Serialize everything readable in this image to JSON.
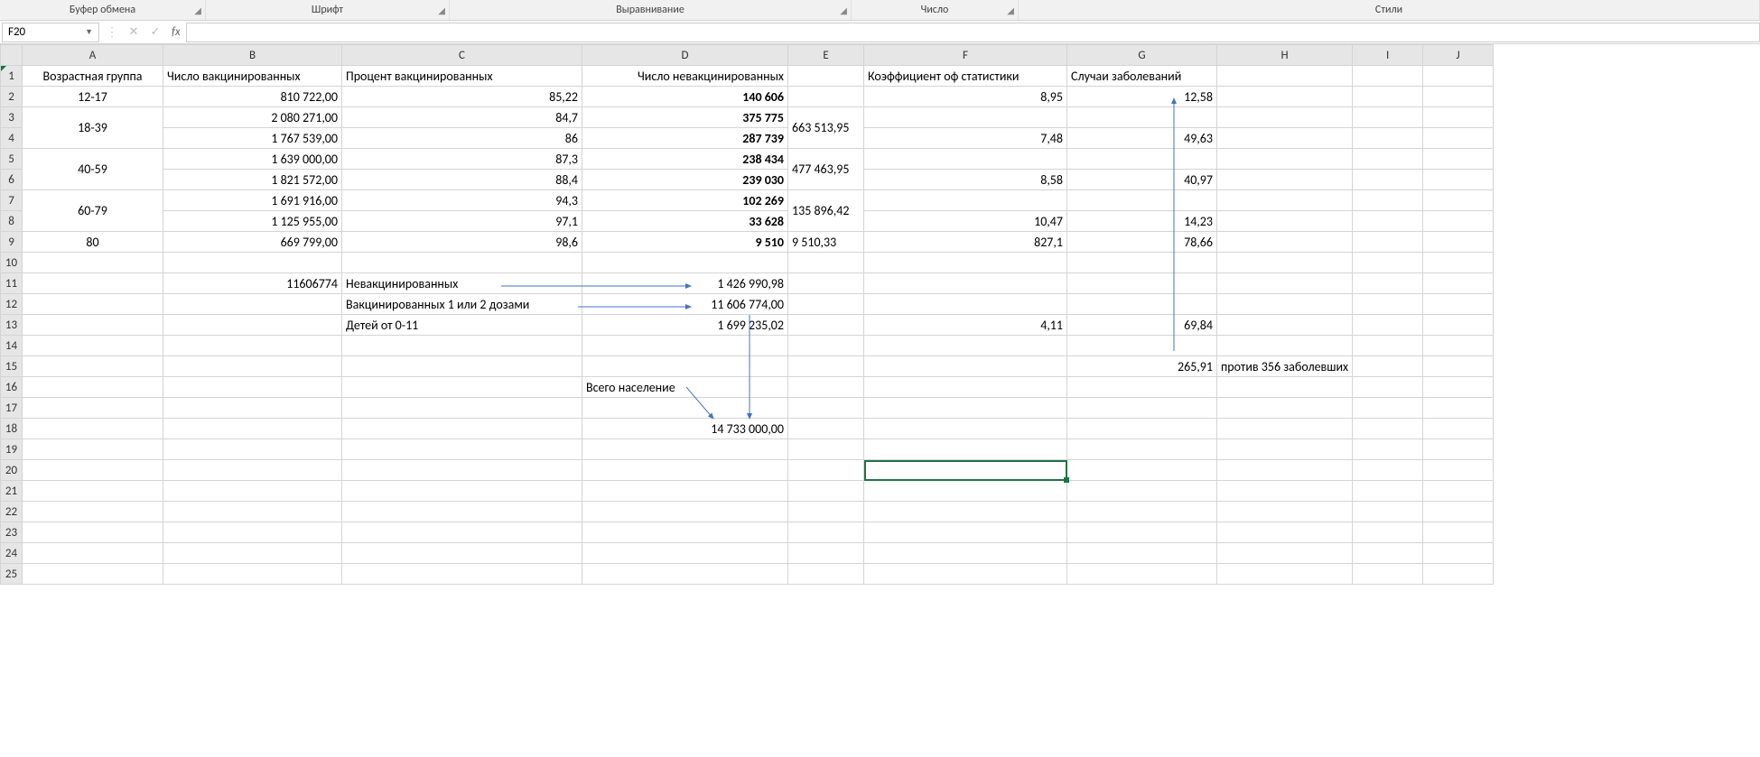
{
  "ribbon": {
    "groups": [
      "Буфер обмена",
      "Шрифт",
      "Выравнивание",
      "Число",
      "Стили"
    ]
  },
  "nameBox": "F20",
  "fx": "fx",
  "columns": [
    "A",
    "B",
    "C",
    "D",
    "E",
    "F",
    "G",
    "H",
    "I",
    "J"
  ],
  "rows": [
    "1",
    "2",
    "3",
    "4",
    "5",
    "6",
    "7",
    "8",
    "9",
    "10",
    "11",
    "12",
    "13",
    "14",
    "15",
    "16",
    "17",
    "18",
    "19",
    "20",
    "21",
    "22",
    "23",
    "24",
    "25"
  ],
  "cells": {
    "A1": "Возрастная группа",
    "B1": "Число вакцинированных",
    "C1": "Процент вакцинированных",
    "D1": "Число невакцинированных",
    "F1": "Коэффициент оф статистики",
    "G1": "Случаи заболеваний",
    "A2": "12-17",
    "B2": "810 722,00",
    "C2": "85,22",
    "D2": "140 606",
    "F2": "8,95",
    "G2": "12,58",
    "A3": "18-39",
    "B3": "2 080 271,00",
    "C3": "84,7",
    "D3": "375 775",
    "E3": "663 513,95",
    "B4": "1 767 539,00",
    "C4": "86",
    "D4": "287 739",
    "F4": "7,48",
    "G4": "49,63",
    "A5": "40-59",
    "B5": "1 639 000,00",
    "C5": "87,3",
    "D5": "238 434",
    "E5": "477 463,95",
    "B6": "1 821 572,00",
    "C6": "88,4",
    "D6": "239 030",
    "F6": "8,58",
    "G6": "40,97",
    "A7": "60-79",
    "B7": "1 691 916,00",
    "C7": "94,3",
    "D7": "102 269",
    "E7": "135 896,42",
    "B8": "1 125 955,00",
    "C8": "97,1",
    "D8": "33 628",
    "F8": "10,47",
    "G8": "14,23",
    "A9": "80",
    "B9": "669 799,00",
    "C9": "98,6",
    "D9": "9 510",
    "E9": "9 510,33",
    "F9": "827,1",
    "G9": "78,66",
    "B11": "11606774",
    "C11": "Невакцинированных",
    "D11": "1 426 990,98",
    "C12": "Вакцинированных 1 или 2 дозами",
    "D12": "11 606 774,00",
    "C13": "Детей от 0-11",
    "D13": "1 699 235,02",
    "F13": "4,11",
    "G13": "69,84",
    "G15": "265,91",
    "H15": "против 356 заболевших",
    "D16": "Всего население",
    "D18": "14 733 000,00"
  }
}
